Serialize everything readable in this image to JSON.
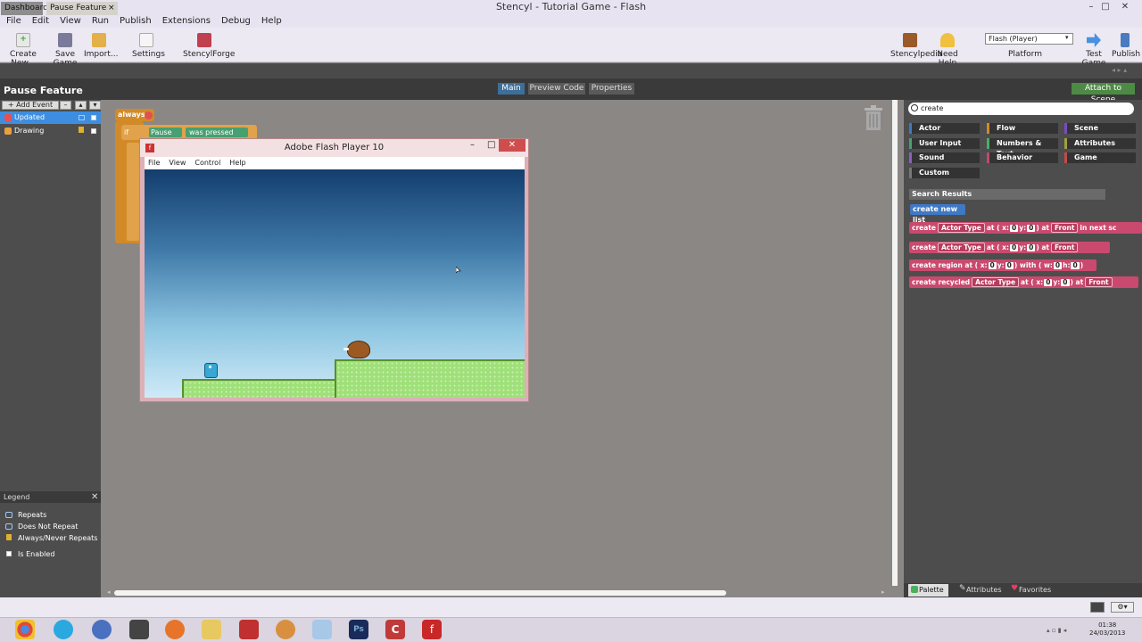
{
  "window": {
    "title": "Stencyl - Tutorial Game - Flash",
    "icon_letter": "C"
  },
  "menu": [
    "File",
    "Edit",
    "View",
    "Run",
    "Publish",
    "Extensions",
    "Debug",
    "Help"
  ],
  "toolbar": {
    "create": "Create New...",
    "save": "Save Game",
    "import": "Import...",
    "settings": "Settings",
    "forge": "StencylForge",
    "pedia": "Stencylpedia",
    "help": "Need Help",
    "platform_value": "Flash (Player)",
    "platform_label": "Platform",
    "test": "Test Game",
    "publish": "Publish"
  },
  "tabs": {
    "dashboard": "Dashboard",
    "pause": "Pause Feature",
    "close": "×"
  },
  "header": {
    "title": "Pause Feature",
    "main": "Main",
    "preview": "Preview Code",
    "properties": "Properties",
    "attach": "Attach to Scene"
  },
  "events": {
    "add": "+ Add Event",
    "items": [
      "Updated",
      "Drawing"
    ]
  },
  "legend": {
    "title": "Legend",
    "close": "✕",
    "items": [
      "Repeats",
      "Does Not Repeat",
      "Always/Never Repeats",
      "Is Enabled"
    ]
  },
  "blocks": {
    "always": "always",
    "if": "if",
    "pause": "Pause",
    "pressed": "was pressed"
  },
  "flash": {
    "title": "Adobe Flash Player 10",
    "menu": [
      "File",
      "View",
      "Control",
      "Help"
    ],
    "min": "–",
    "max": "□",
    "close": "✕"
  },
  "palette": {
    "search": "create",
    "categories": [
      "Actor",
      "Flow",
      "Scene",
      "User Input",
      "Numbers & Text",
      "Attributes",
      "Sound",
      "Behavior",
      "Game",
      "Custom"
    ],
    "results_title": "Search Results",
    "new_list": "create new list",
    "results": [
      {
        "a": "create",
        "t": "Actor Type",
        "b": "at ( x:",
        "x": "0",
        "c": "y:",
        "y": "0",
        "d": ") at",
        "l": "Front",
        "e": "in next sc"
      },
      {
        "a": "create",
        "t": "Actor Type",
        "b": "at ( x:",
        "x": "0",
        "c": "y:",
        "y": "0",
        "d": ") at",
        "l": "Front",
        "e": ""
      }
    ],
    "region": "create region at ( x:",
    "region_w": ") with ( w:",
    "region_h": "h:",
    "recycled": "create recycled",
    "tabs": [
      "Palette",
      "Attributes",
      "Favorites"
    ]
  },
  "clock": {
    "time": "01:38",
    "date": "24/03/2013"
  }
}
